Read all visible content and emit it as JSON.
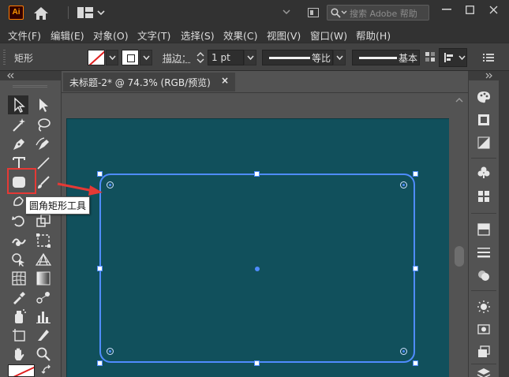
{
  "app": {
    "logo_text": "Ai",
    "search_placeholder": "搜索 Adobe 帮助"
  },
  "menu": {
    "items": [
      "文件(F)",
      "编辑(E)",
      "对象(O)",
      "文字(T)",
      "选择(S)",
      "效果(C)",
      "视图(V)",
      "窗口(W)",
      "帮助(H)"
    ]
  },
  "control_bar": {
    "object_type": "矩形",
    "stroke_label": "描边：",
    "stroke_weight": "1 pt",
    "profile_label": "等比",
    "brush_label": "基本"
  },
  "document": {
    "tab_title": "未标题-2* @ 74.3% (RGB/预览)",
    "close_glyph": "×"
  },
  "toolbar": {
    "tooltip": "圆角矩形工具",
    "active_tool": "selection-tool",
    "highlighted_tool": "rounded-rectangle-tool"
  },
  "colors": {
    "artboard_fill": "#11505c",
    "selection": "#4f8cff",
    "highlight": "#e53935"
  }
}
